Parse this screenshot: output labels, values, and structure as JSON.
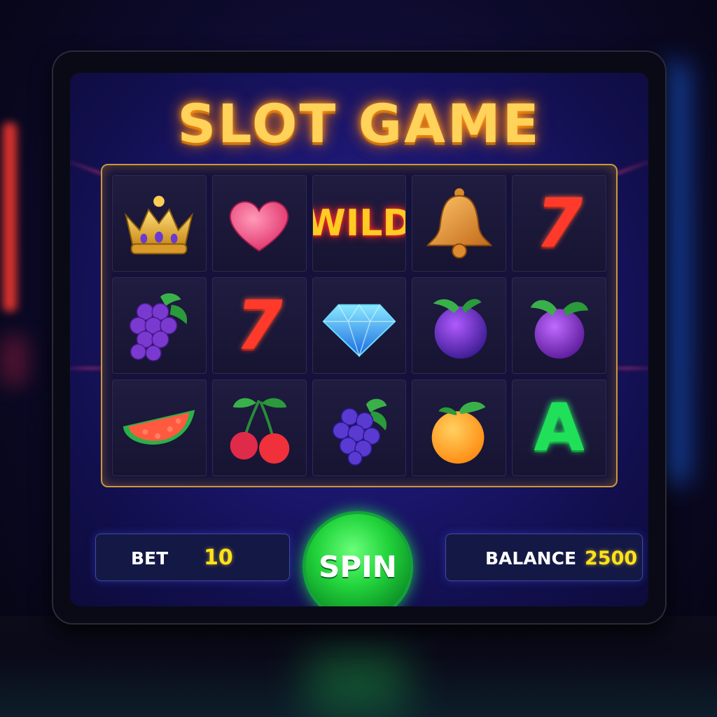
{
  "title": "SLOT GAME",
  "reels": [
    [
      {
        "icon": "crown-icon"
      },
      {
        "icon": "heart-icon"
      },
      {
        "icon": "wild-symbol",
        "text": "WILD"
      },
      {
        "icon": "bell-icon"
      },
      {
        "icon": "seven-symbol",
        "text": "7"
      }
    ],
    [
      {
        "icon": "grapes-icon"
      },
      {
        "icon": "seven-symbol",
        "text": "7"
      },
      {
        "icon": "diamond-icon"
      },
      {
        "icon": "plum-icon"
      },
      {
        "icon": "plum-icon"
      }
    ],
    [
      {
        "icon": "watermelon-icon"
      },
      {
        "icon": "cherries-icon"
      },
      {
        "icon": "grapes-icon"
      },
      {
        "icon": "orange-icon"
      },
      {
        "icon": "letter-a-symbol",
        "text": "A"
      }
    ]
  ],
  "bet": {
    "label": "BET",
    "value": "10"
  },
  "spin_label": "SPIN",
  "balance": {
    "label": "BALANCE",
    "value": "2500"
  },
  "colors": {
    "accent_gold": "#ffd25a",
    "spin_green": "#22d43c",
    "value_yellow": "#ffe21a",
    "screen_blue": "#1c1770"
  }
}
